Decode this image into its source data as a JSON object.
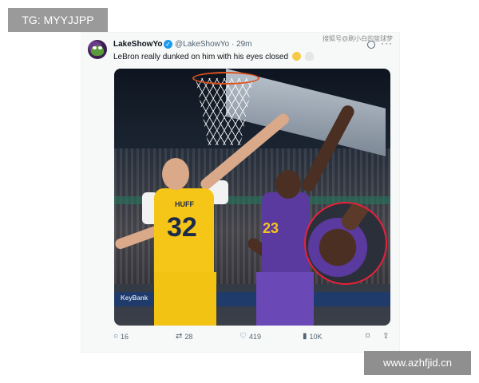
{
  "overlay": {
    "top_left_tag": "TG: MYYJJPP",
    "bottom_right_tag": "www.azhfjid.cn",
    "source_watermark": "搜狐号@刷小白的篮球梦"
  },
  "tweet": {
    "display_name": "LakeShowYo",
    "handle_time": "@LakeShowYo · 29m",
    "text": "LeBron really dunked on him with his eyes closed",
    "emojis": [
      "crying-face",
      "skull"
    ],
    "photo": {
      "jersey_name": "HUFF",
      "jersey_number": "32",
      "opponent_number": "23",
      "arena_sign": "KeyBank"
    }
  },
  "actions": {
    "reply_count": "16",
    "retweet_count": "28",
    "like_count": "419",
    "views_count": "10K"
  },
  "colors": {
    "card_bg": "#f7f9f9",
    "verified": "#1d9bf0",
    "highlight_circle": "#e8213a",
    "pacers_yellow": "#f5c518",
    "lakers_purple": "#5a3a9e"
  }
}
